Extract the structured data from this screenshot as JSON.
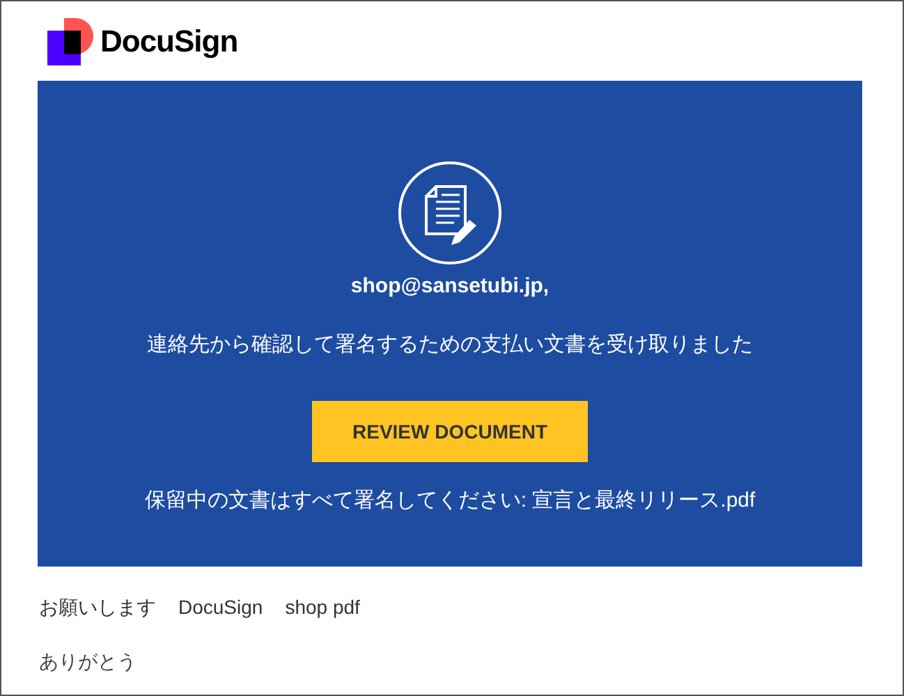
{
  "logo": {
    "text": "DocuSign"
  },
  "banner": {
    "recipient": "shop@sansetubi.jp,",
    "message": "連絡先から確認して署名するための支払い文書を受け取りました",
    "button": "REVIEW DOCUMENT",
    "note": "保留中の文書はすべて署名してください: 宣言と最終リリース.pdf"
  },
  "footer": {
    "line_1": [
      "お願いします",
      "DocuSign",
      "shop pdf"
    ],
    "line_2": "ありがとう"
  }
}
